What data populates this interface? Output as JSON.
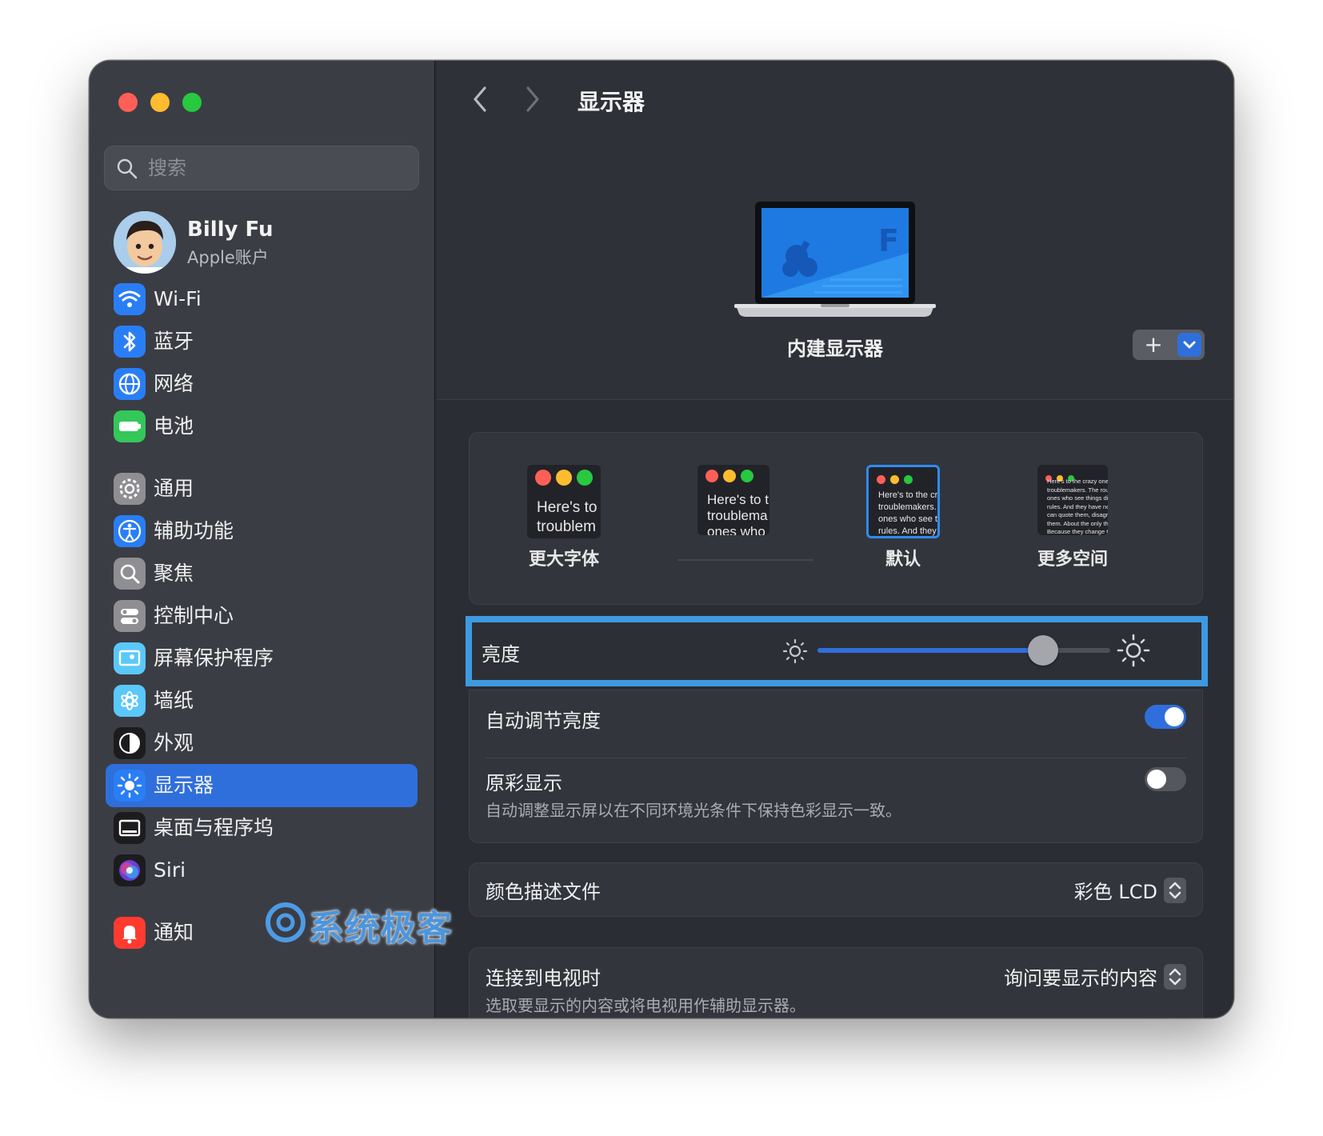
{
  "window": {
    "traffic_lights": {
      "close": "#ff5f57",
      "minimize": "#febc2e",
      "zoom": "#28c840"
    }
  },
  "sidebar": {
    "search_placeholder": "搜索",
    "account": {
      "name": "Billy Fu",
      "subtitle": "Apple账户"
    },
    "items": [
      {
        "label": "Wi-Fi",
        "icon": "wifi-icon",
        "color": "#2a7ef5"
      },
      {
        "label": "蓝牙",
        "icon": "bluetooth-icon",
        "color": "#2a7ef5"
      },
      {
        "label": "网络",
        "icon": "globe-icon",
        "color": "#2a7ef5"
      },
      {
        "label": "电池",
        "icon": "battery-icon",
        "color": "#34c759"
      },
      {
        "label": "通用",
        "icon": "gear-icon",
        "color": "#8e8e93"
      },
      {
        "label": "辅助功能",
        "icon": "accessibility-icon",
        "color": "#2a7ef5"
      },
      {
        "label": "聚焦",
        "icon": "spotlight-icon",
        "color": "#8e8e93"
      },
      {
        "label": "控制中心",
        "icon": "control-center-icon",
        "color": "#8e8e93"
      },
      {
        "label": "屏幕保护程序",
        "icon": "screensaver-icon",
        "color": "#5ac8fa"
      },
      {
        "label": "墙纸",
        "icon": "wallpaper-icon",
        "color": "#5ac8fa"
      },
      {
        "label": "外观",
        "icon": "appearance-icon",
        "color": "#1c1c1e"
      },
      {
        "label": "显示器",
        "icon": "display-sun-icon",
        "color": "#2a7ef5",
        "active": true
      },
      {
        "label": "桌面与程序坞",
        "icon": "dock-icon",
        "color": "#1c1c1e"
      },
      {
        "label": "Siri",
        "icon": "siri-icon",
        "color": "#1c1c1e"
      },
      {
        "label": "通知",
        "icon": "bell-icon",
        "color": "#ff3b30"
      }
    ],
    "accent": "#2f6fdb"
  },
  "header": {
    "title": "显示器"
  },
  "display": {
    "name": "内建显示器",
    "add_label": "+"
  },
  "resolution": {
    "options": [
      {
        "label": "更大字体",
        "preview": "Here's to\ntroublem",
        "selected": false
      },
      {
        "label": "",
        "preview": "Here's to t\ntroublema\nones who",
        "selected": false
      },
      {
        "label": "默认",
        "preview": "Here's to the cr\ntroublemakers.\nones who see t\nrules. And they",
        "selected": true
      },
      {
        "label": "更多空间",
        "preview": "Here's to the crazy one\ntroublemakers. The rou\nones who see things di\nrules. And they have no\ncan quote them, disagr\nthem. About the only th\nBecause they change th",
        "selected": false
      }
    ]
  },
  "brightness": {
    "label": "亮度",
    "level": 0.77
  },
  "auto_brightness": {
    "label": "自动调节亮度",
    "on": true
  },
  "true_tone": {
    "label": "原彩显示",
    "description": "自动调整显示屏以在不同环境光条件下保持色彩显示一致。",
    "on": false
  },
  "color_profile": {
    "label": "颜色描述文件",
    "value": "彩色 LCD"
  },
  "tv": {
    "label": "连接到电视时",
    "description": "选取要显示的内容或将电视用作辅助显示器。",
    "value": "询问要显示的内容"
  },
  "watermark": {
    "text": "系统极客"
  }
}
